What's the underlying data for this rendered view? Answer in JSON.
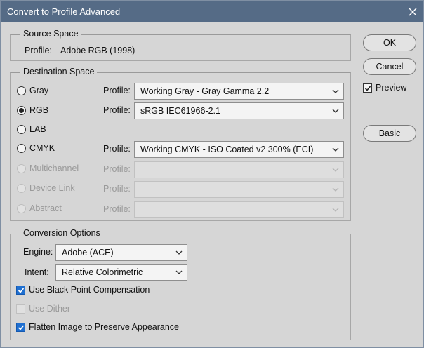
{
  "window": {
    "title": "Convert to Profile Advanced"
  },
  "source": {
    "legend": "Source Space",
    "profile_label": "Profile:",
    "profile_value": "Adobe RGB (1998)"
  },
  "destination": {
    "legend": "Destination Space",
    "profile_label": "Profile:",
    "options": [
      {
        "label": "Gray",
        "selected": false,
        "enabled": true,
        "profile": "Working Gray - Gray Gamma 2.2"
      },
      {
        "label": "RGB",
        "selected": true,
        "enabled": true,
        "profile": "sRGB IEC61966-2.1"
      },
      {
        "label": "LAB",
        "selected": false,
        "enabled": true,
        "profile": null
      },
      {
        "label": "CMYK",
        "selected": false,
        "enabled": true,
        "profile": "Working CMYK - ISO Coated v2 300% (ECI)"
      },
      {
        "label": "Multichannel",
        "selected": false,
        "enabled": false,
        "profile": ""
      },
      {
        "label": "Device Link",
        "selected": false,
        "enabled": false,
        "profile": ""
      },
      {
        "label": "Abstract",
        "selected": false,
        "enabled": false,
        "profile": ""
      }
    ]
  },
  "conversion": {
    "legend": "Conversion Options",
    "engine_label": "Engine:",
    "engine_value": "Adobe (ACE)",
    "intent_label": "Intent:",
    "intent_value": "Relative Colorimetric",
    "black_point": {
      "label": "Use Black Point Compensation",
      "checked": true,
      "enabled": true
    },
    "dither": {
      "label": "Use Dither",
      "checked": false,
      "enabled": false
    },
    "flatten": {
      "label": "Flatten Image to Preserve Appearance",
      "checked": true,
      "enabled": true
    }
  },
  "buttons": {
    "ok": "OK",
    "cancel": "Cancel",
    "basic": "Basic"
  },
  "preview": {
    "label": "Preview",
    "checked": true
  },
  "colors": {
    "titlebar": "#556b86",
    "accent": "#1f6fd0",
    "dialog_bg": "#d6d6d6"
  }
}
